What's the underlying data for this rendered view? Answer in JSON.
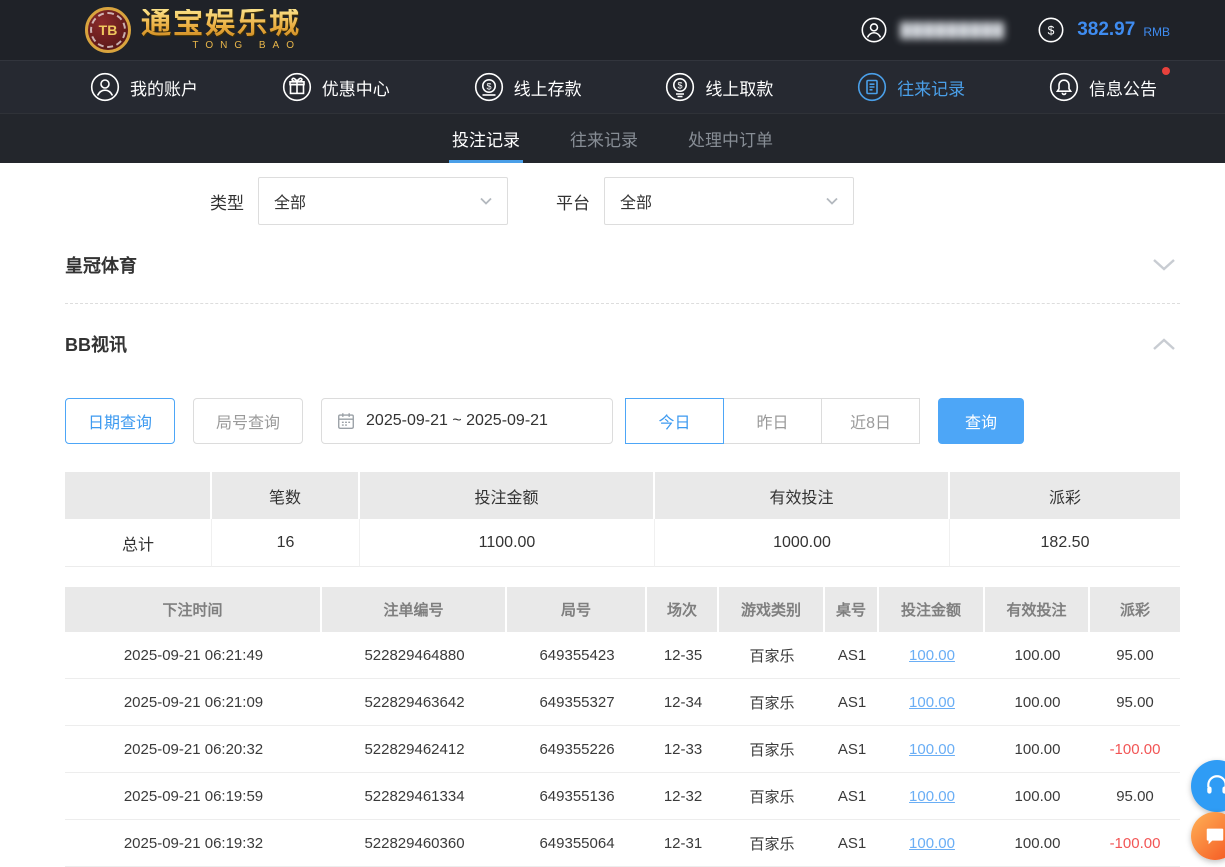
{
  "brand": {
    "badge": "TB",
    "name": "通宝娱乐城",
    "subtitle": "TONG BAO"
  },
  "header": {
    "username_masked": "█████████",
    "balance": "382.97",
    "currency": "RMB"
  },
  "nav": {
    "items": [
      {
        "label": "我的账户"
      },
      {
        "label": "优惠中心"
      },
      {
        "label": "线上存款"
      },
      {
        "label": "线上取款"
      },
      {
        "label": "往来记录"
      },
      {
        "label": "信息公告"
      }
    ]
  },
  "tabs": {
    "items": [
      {
        "label": "投注记录"
      },
      {
        "label": "往来记录"
      },
      {
        "label": "处理中订单"
      }
    ]
  },
  "filters": {
    "type_label": "类型",
    "type_value": "全部",
    "platform_label": "平台",
    "platform_value": "全部"
  },
  "sections": {
    "crown": {
      "title": "皇冠体育"
    },
    "bb": {
      "title": "BB视讯"
    }
  },
  "query": {
    "date_query": "日期查询",
    "round_query": "局号查询",
    "date_range": "2025-09-21 ~ 2025-09-21",
    "today": "今日",
    "yesterday": "昨日",
    "last8": "近8日",
    "search": "查询"
  },
  "summary": {
    "headers": {
      "count": "笔数",
      "bet": "投注金额",
      "valid": "有效投注",
      "payout": "派彩"
    },
    "total_label": "总计",
    "count": "16",
    "bet": "1100.00",
    "valid": "1000.00",
    "payout": "182.50"
  },
  "table": {
    "headers": [
      "下注时间",
      "注单编号",
      "局号",
      "场次",
      "游戏类别",
      "桌号",
      "投注金额",
      "有效投注",
      "派彩"
    ],
    "rows": [
      [
        "2025-09-21 06:21:49",
        "522829464880",
        "649355423",
        "12-35",
        "百家乐",
        "AS1",
        "100.00",
        "100.00",
        "95.00"
      ],
      [
        "2025-09-21 06:21:09",
        "522829463642",
        "649355327",
        "12-34",
        "百家乐",
        "AS1",
        "100.00",
        "100.00",
        "95.00"
      ],
      [
        "2025-09-21 06:20:32",
        "522829462412",
        "649355226",
        "12-33",
        "百家乐",
        "AS1",
        "100.00",
        "100.00",
        "-100.00"
      ],
      [
        "2025-09-21 06:19:59",
        "522829461334",
        "649355136",
        "12-32",
        "百家乐",
        "AS1",
        "100.00",
        "100.00",
        "95.00"
      ],
      [
        "2025-09-21 06:19:32",
        "522829460360",
        "649355064",
        "12-31",
        "百家乐",
        "AS1",
        "100.00",
        "100.00",
        "-100.00"
      ]
    ]
  },
  "colors": {
    "accent": "#4aa0f0",
    "negative": "#f25555",
    "dark_bar": "#24272d"
  }
}
